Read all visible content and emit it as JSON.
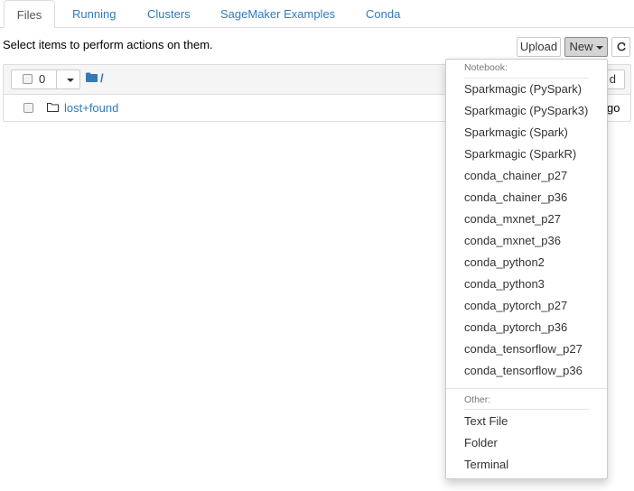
{
  "tabs": [
    {
      "label": "Files",
      "active": true
    },
    {
      "label": "Running",
      "active": false
    },
    {
      "label": "Clusters",
      "active": false
    },
    {
      "label": "SageMaker Examples",
      "active": false
    },
    {
      "label": "Conda",
      "active": false
    }
  ],
  "toolbar": {
    "hint": "Select items to perform actions on them.",
    "upload_label": "Upload",
    "new_label": "New",
    "refresh_icon": "refresh-icon"
  },
  "file_list": {
    "selected_count": "0",
    "breadcrumb": "/",
    "partially_hidden_button": "d",
    "rows": [
      {
        "name": "lost+found",
        "type_icon": "folder-icon",
        "meta": "go"
      }
    ]
  },
  "new_menu": {
    "notebook_header": "Notebook:",
    "notebook_items": [
      "Sparkmagic (PySpark)",
      "Sparkmagic (PySpark3)",
      "Sparkmagic (Spark)",
      "Sparkmagic (SparkR)",
      "conda_chainer_p27",
      "conda_chainer_p36",
      "conda_mxnet_p27",
      "conda_mxnet_p36",
      "conda_python2",
      "conda_python3",
      "conda_pytorch_p27",
      "conda_pytorch_p36",
      "conda_tensorflow_p27",
      "conda_tensorflow_p36"
    ],
    "other_header": "Other:",
    "other_items": [
      "Text File",
      "Folder",
      "Terminal"
    ]
  },
  "colors": {
    "link": "#337ab7",
    "folder_icon": "#337ab7",
    "active_button_bg": "#d4d4d4"
  }
}
